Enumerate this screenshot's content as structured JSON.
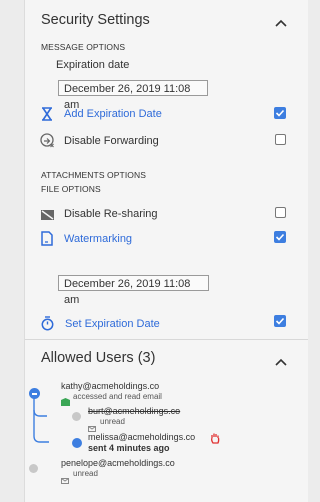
{
  "security": {
    "title": "Security Settings",
    "message_options_label": "MESSAGE OPTIONS",
    "expiration_date_label": "Expiration date",
    "expiration_date_value": "December 26, 2019 11:08 am",
    "add_expiration_label": "Add Expiration Date",
    "add_expiration_checked": true,
    "disable_forwarding_label": "Disable Forwarding",
    "disable_forwarding_checked": false,
    "attachments_options_label": "ATTACHMENTS OPTIONS",
    "file_options_label": "FILE OPTIONS",
    "disable_resharing_label": "Disable Re-sharing",
    "disable_resharing_checked": false,
    "watermarking_label": "Watermarking",
    "watermarking_checked": true,
    "file_expiration_value": "December 26, 2019 11:08 am",
    "set_expiration_label": "Set Expiration Date",
    "set_expiration_checked": true
  },
  "allowed_users": {
    "title": "Allowed Users (3)",
    "users": [
      {
        "email": "kathy@acmeholdings.co",
        "status": "accessed and read email",
        "color": "#3d7ee0",
        "icon": "envelope-open-icon"
      },
      {
        "email": "burt@acmeholdings.co",
        "status": "unread",
        "color": "#c8c8c8",
        "icon": "envelope-icon"
      },
      {
        "email": "melissa@acmeholdings.co",
        "status": "sent 4 minutes ago",
        "color": "#3d7ee0",
        "icon": "hand-icon"
      },
      {
        "email": "penelope@acmeholdings.co",
        "status": "unread",
        "color": "#c8c8c8",
        "icon": "envelope-icon"
      }
    ]
  },
  "colors": {
    "accent": "#2f6bd9",
    "checkbox": "#3d7ee0",
    "stop": "#e03030",
    "read": "#3aa655"
  }
}
